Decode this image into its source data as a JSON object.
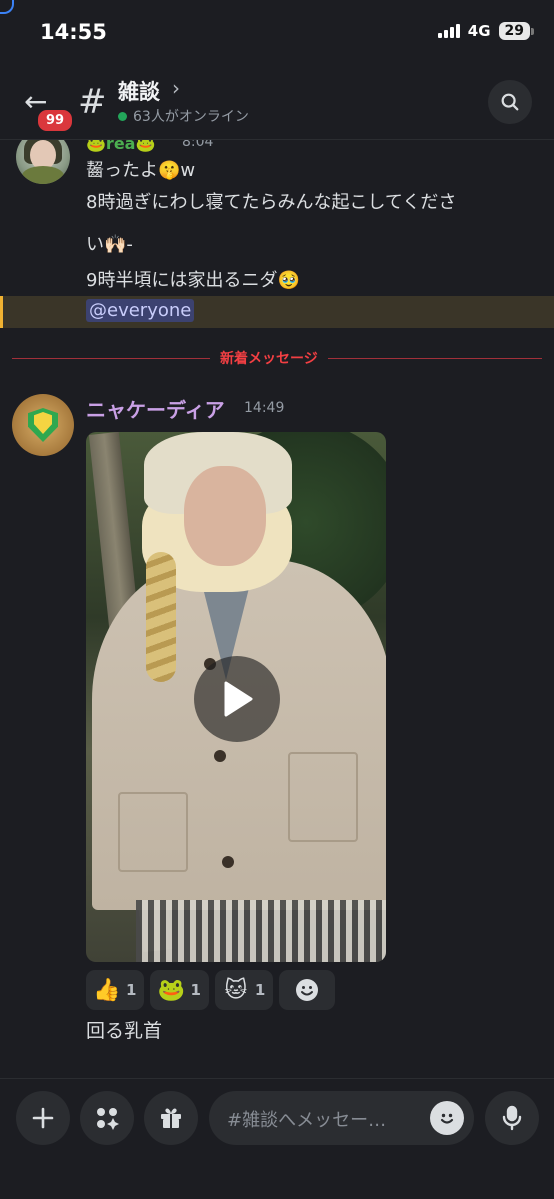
{
  "status_bar": {
    "time": "14:55",
    "network": "4G",
    "battery": "29"
  },
  "header": {
    "unread_count": "99",
    "channel_name": "雑談",
    "online_text": "63人がオンライン"
  },
  "messages": {
    "first": {
      "author": "🐸rea🐸",
      "time": "8:04",
      "lines": [
        "齧ったよ🤫w",
        "8時過ぎにわし寝てたらみんな起こしてくださ",
        "い🙌🏻-",
        "9時半頃には家出るニダ🥹"
      ],
      "mention": "@everyone"
    },
    "new_divider": "新着メッセージ",
    "second": {
      "author": "ニャケーディア",
      "time": "14:49",
      "reactions": [
        {
          "emoji": "👍",
          "count": "1"
        },
        {
          "emoji": "🐸",
          "count": "1"
        },
        {
          "emoji": "🐱",
          "count": "1"
        }
      ],
      "caption": "回る乳首"
    }
  },
  "composer": {
    "placeholder": "#雑談へメッセー…"
  }
}
